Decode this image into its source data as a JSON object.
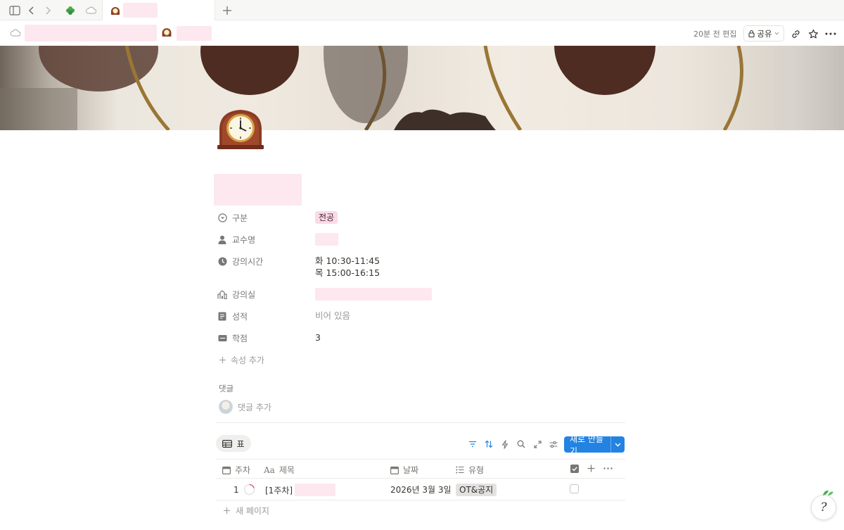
{
  "header": {
    "edited_label": "20분 전 편집",
    "share_label": "공유"
  },
  "properties": [
    {
      "label": "구분",
      "value": "전공",
      "icon": "select-icon"
    },
    {
      "label": "교수명",
      "icon": "person-icon"
    },
    {
      "label": "강의시간",
      "value_line1": "화 10:30-11:45",
      "value_line2": "목 15:00-16:15",
      "icon": "clock-icon"
    },
    {
      "label": "강의실",
      "icon": "building-icon"
    },
    {
      "label": "성적",
      "value": "비어 있음",
      "icon": "document-icon"
    },
    {
      "label": "학점",
      "value": "3",
      "icon": "number-icon"
    }
  ],
  "add_property_label": "속성 추가",
  "comments": {
    "section_label": "댓글",
    "add_label": "댓글 추가"
  },
  "database": {
    "view_tab_label": "표",
    "new_button_label": "새로 만들기",
    "columns": [
      "주차",
      "제목",
      "날짜",
      "유형"
    ],
    "rows": [
      {
        "week": "1",
        "title": "[1주차]",
        "date": "2026년 3월 3일",
        "type": "OT&공지"
      }
    ],
    "new_page_label": "새 페이지"
  },
  "colors": {
    "accent": "#2383e2",
    "major_tag_bg": "#f9dbe5",
    "redaction": "#fde8ef"
  },
  "help_glyph": "?"
}
